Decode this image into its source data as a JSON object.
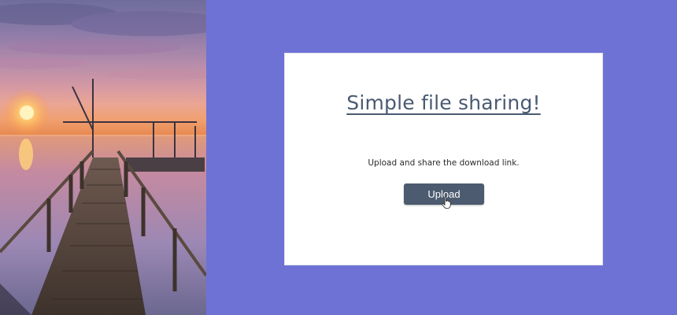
{
  "page": {
    "title": "Simple file sharing!",
    "description": "Upload and share the download link.",
    "upload_button_label": "Upload"
  },
  "hero_image": {
    "icon": "sunset-pier-photo"
  },
  "colors": {
    "background": "#6e72d4",
    "card": "#ffffff",
    "title": "#4a5a72",
    "button": "#4c5b6f",
    "button_text": "#ffffff"
  },
  "cursor": {
    "icon": "hand-pointer-icon"
  }
}
